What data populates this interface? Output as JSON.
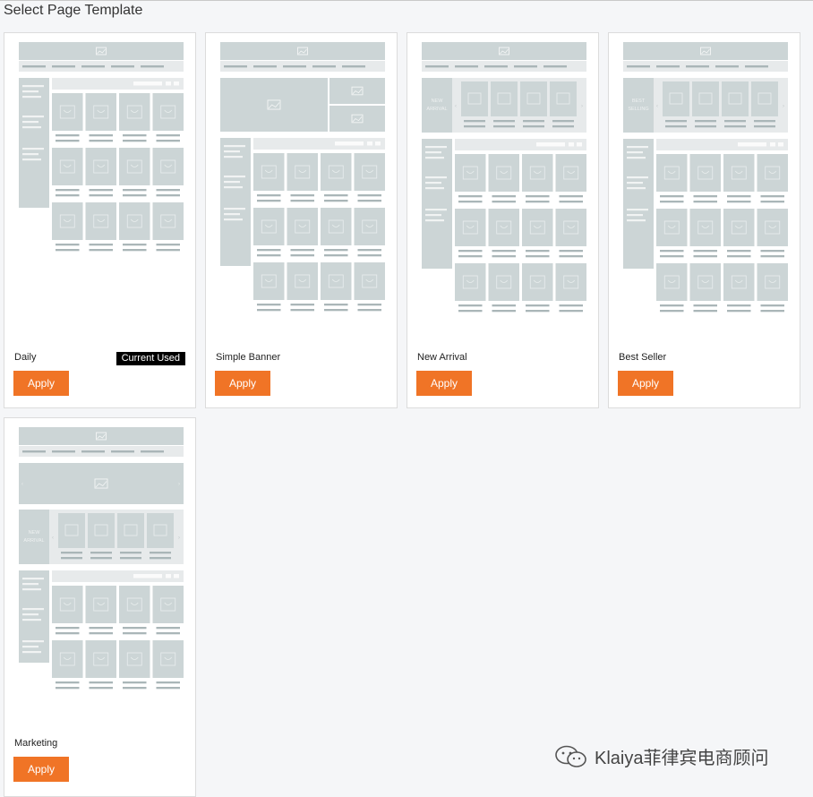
{
  "page": {
    "title": "Select Page Template"
  },
  "templates": [
    {
      "name": "Daily",
      "badge": "Current Used",
      "apply_label": "Apply",
      "layout": "daily"
    },
    {
      "name": "Simple Banner",
      "apply_label": "Apply",
      "layout": "simple-banner"
    },
    {
      "name": "New Arrival",
      "apply_label": "Apply",
      "layout": "new-arrival",
      "slider_label": [
        "NEW",
        "ARRIVAL"
      ]
    },
    {
      "name": "Best Seller",
      "apply_label": "Apply",
      "layout": "best-seller",
      "slider_label": [
        "BEST",
        "SELLING"
      ]
    },
    {
      "name": "Marketing",
      "apply_label": "Apply",
      "layout": "marketing",
      "slider_label": [
        "NEW",
        "ARRIVAL"
      ]
    }
  ],
  "watermark": {
    "text": "Klaiya菲律宾电商顾问",
    "icon": "wechat-icon"
  },
  "colors": {
    "accent": "#f07426",
    "wireframe_block": "#ccd5d6",
    "wireframe_bar": "#aab6b8",
    "wireframe_bg": "#e7eaeb"
  }
}
